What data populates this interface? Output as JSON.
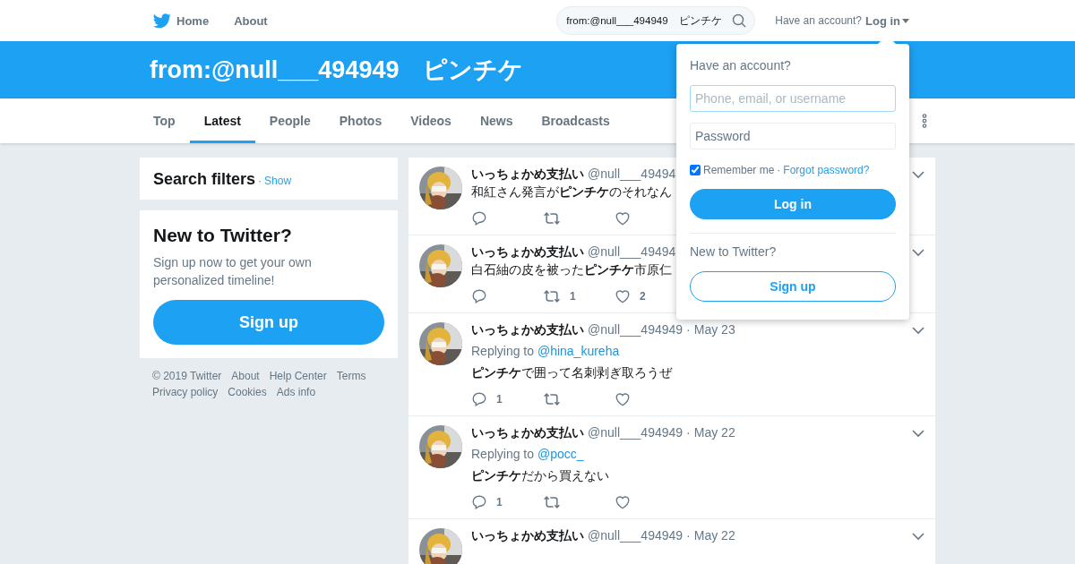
{
  "nav": {
    "links": [
      {
        "label": "Home"
      },
      {
        "label": "About"
      }
    ],
    "search": {
      "value": "from:@null___494949　ピンチケ"
    },
    "account_prompt": "Have an account?",
    "login_label": "Log in"
  },
  "banner": {
    "title": "from:@null___494949　ピンチケ"
  },
  "tabs": [
    {
      "label": "Top",
      "selected": false
    },
    {
      "label": "Latest",
      "selected": true
    },
    {
      "label": "People",
      "selected": false
    },
    {
      "label": "Photos",
      "selected": false
    },
    {
      "label": "Videos",
      "selected": false
    },
    {
      "label": "News",
      "selected": false
    },
    {
      "label": "Broadcasts",
      "selected": false
    }
  ],
  "sidebar": {
    "filters_title": "Search filters",
    "filters_separator": "·",
    "filters_link": "Show",
    "signup_title": "New to Twitter?",
    "signup_text": "Sign up now to get your own personalized timeline!",
    "signup_button": "Sign up",
    "footer_links": [
      "© 2019 Twitter",
      "About",
      "Help Center",
      "Terms",
      "Privacy policy",
      "Cookies",
      "Ads info"
    ]
  },
  "tweets": [
    {
      "name": "いっちょかめ支払い",
      "handle": "@null___49494",
      "text": "和紅さん発言が**ピンチケ**のそれなん"
    },
    {
      "name": "いっちょかめ支払い",
      "handle": "@null___49494",
      "text": "白石紬の皮を被った**ピンチケ**市原仁",
      "retweet_count": "1",
      "like_count": "2"
    },
    {
      "name": "いっちょかめ支払い",
      "handle": "@null___494949",
      "separator": "·",
      "date": "May 23",
      "replying_label": "Replying to",
      "replying_to": "@hina_kureha",
      "text": "**ピンチケ**で囲って名刺剥ぎ取ろうぜ",
      "reply_count": "1"
    },
    {
      "name": "いっちょかめ支払い",
      "handle": "@null___494949",
      "separator": "·",
      "date": "May 22",
      "replying_label": "Replying to",
      "replying_to": "@pocc_",
      "text": "**ピンチケ**だから買えない",
      "reply_count": "1"
    },
    {
      "name": "いっちょかめ支払い",
      "handle": "@null___494949",
      "separator": "·",
      "date": "May 22"
    }
  ],
  "login_dropdown": {
    "title": "Have an account?",
    "username_placeholder": "Phone, email, or username",
    "password_placeholder": "Password",
    "remember_checked": true,
    "remember_label": "Remember me",
    "separator": "·",
    "forgot_link": "Forgot password?",
    "login_button": "Log in",
    "new_title": "New to Twitter?",
    "signup_button": "Sign up"
  }
}
